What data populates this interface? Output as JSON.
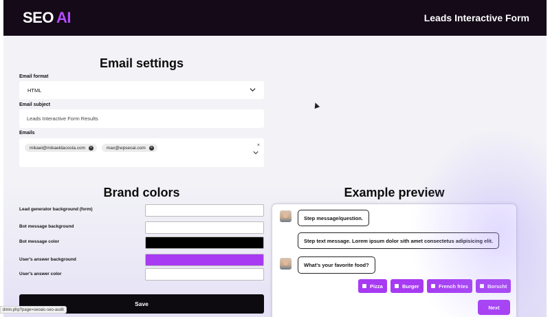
{
  "header": {
    "logo_seo": "SEO",
    "logo_ai": "AI",
    "title": "Leads Interactive Form"
  },
  "email_settings": {
    "title": "Email settings",
    "format_label": "Email format",
    "format_value": "HTML",
    "subject_label": "Email subject",
    "subject_value": "Leads Interactive Form Results",
    "emails_label": "Emails",
    "emails": [
      "mikael@mikaeldacosta.com",
      "max@wpseoai.com"
    ],
    "clear_symbol": "×"
  },
  "brand_colors": {
    "title": "Brand colors",
    "items": [
      {
        "label": "Lead generator background (form)",
        "color": "#ffffff"
      },
      {
        "label": "Bot message background",
        "color": "#ffffff"
      },
      {
        "label": "Bot message color",
        "color": "#000000"
      },
      {
        "label": "User's answer background",
        "color": "#a73af2"
      },
      {
        "label": "User's answer color",
        "color": "#ffffff"
      }
    ],
    "save_label": "Save"
  },
  "preview": {
    "title": "Example preview",
    "step_message": "Step message/question.",
    "step_text": "Step text message. Lorem ipsum dolor sith amet consectetus adipisicing elit.",
    "question": "What's your favorite food?",
    "options": [
      "Pizza",
      "Burger",
      "French fries",
      "Borscht"
    ],
    "next_label": "Next"
  },
  "status_bar": {
    "url": "dmin.php?page=seoaic-seo-audit"
  },
  "colors": {
    "header_bg": "#140a18",
    "accent": "#a73af2",
    "save_bg": "#0d0a10"
  }
}
